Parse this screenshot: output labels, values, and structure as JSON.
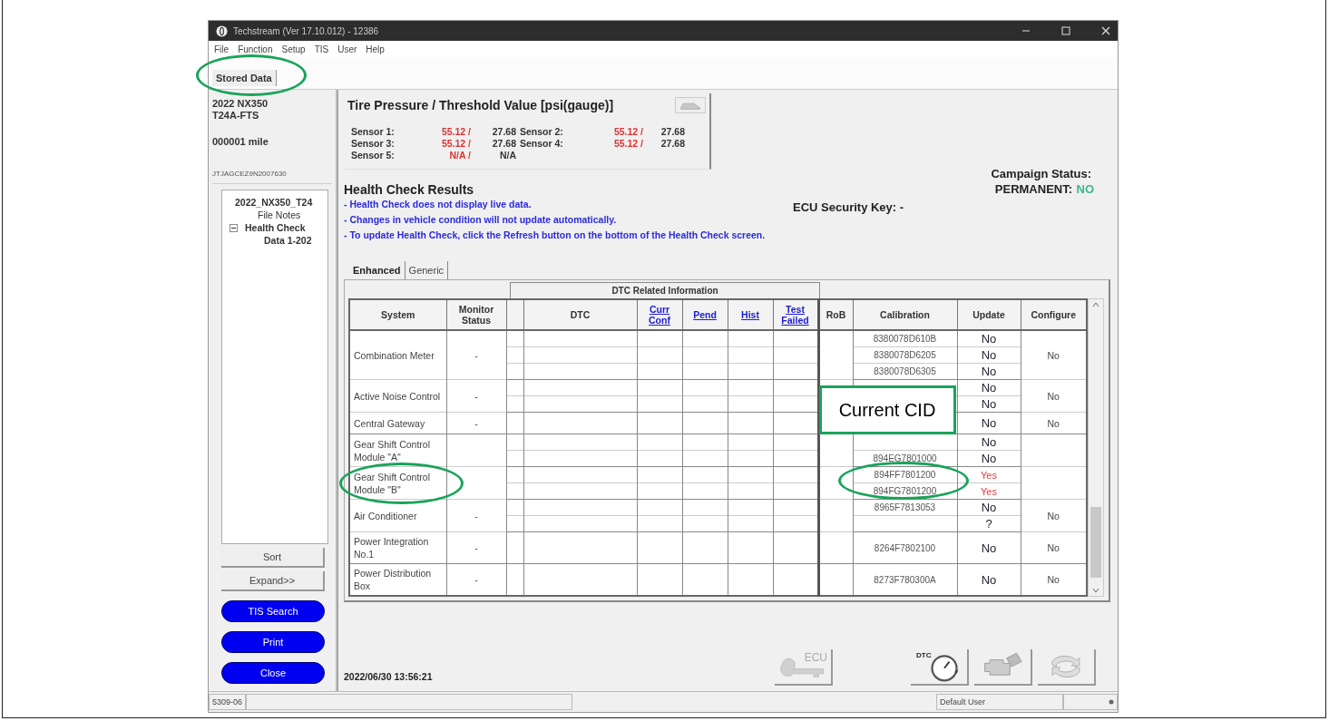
{
  "window": {
    "title": "Techstream (Ver 17.10.012) - 12386"
  },
  "menu": [
    "File",
    "Function",
    "Setup",
    "TIS",
    "User",
    "Help"
  ],
  "toolbar_tabs": [
    {
      "label": "Stored Data",
      "circled": true
    }
  ],
  "vehicle": {
    "model": "2022 NX350",
    "engine": "T24A-FTS",
    "mileage": "000001 mile",
    "vin": "JTJAGCEZ9N2007630"
  },
  "file_tree": [
    {
      "label": "2022_NX350_T24",
      "children": [
        {
          "label": "File Notes",
          "expanded": false
        },
        {
          "label": "Health Check",
          "expanded": true,
          "children": [
            {
              "label": "Data 1-202"
            }
          ]
        }
      ]
    }
  ],
  "side_buttons": [
    {
      "label": "Sort",
      "kind": "plain"
    },
    {
      "label": "Expand>>",
      "kind": "plain"
    },
    {
      "label": "TIS Search",
      "kind": "pill"
    },
    {
      "label": "Print",
      "kind": "pill"
    },
    {
      "label": "Close",
      "kind": "pill"
    }
  ],
  "tire_pressure": {
    "title": "Tire Pressure / Threshold Value [psi(gauge)]",
    "sensors": [
      {
        "label": "Sensor 1:",
        "value": "55.12 /",
        "threshold": "27.68",
        "alert": true
      },
      {
        "label": "Sensor 2:",
        "value": "55.12 /",
        "threshold": "27.68",
        "alert": true
      },
      {
        "label": "Sensor 3:",
        "value": "55.12 /",
        "threshold": "27.68",
        "alert": true
      },
      {
        "label": "Sensor 4:",
        "value": "55.12 /",
        "threshold": "27.68",
        "alert": true
      },
      {
        "label": "Sensor 5:",
        "value": "N/A /",
        "threshold": "N/A",
        "alert": true
      }
    ]
  },
  "campaign": {
    "label": "Campaign Status:",
    "permanent_label": "PERMANENT:",
    "permanent_value": "NO"
  },
  "health_check": {
    "title": "Health Check Results",
    "security_key": "ECU Security Key: -",
    "notes": [
      "- Health Check does not display live data.",
      "- Changes in vehicle condition will not update automatically.",
      "- To update Health Check, click the Refresh button on the bottom of the Health Check screen."
    ]
  },
  "result_tabs": [
    {
      "label": "Enhanced",
      "selected": true
    },
    {
      "label": "Generic",
      "selected": false
    }
  ],
  "table": {
    "group_header": "DTC Related Information",
    "columns": [
      {
        "label": "System",
        "kind": "text"
      },
      {
        "label": "Monitor Status",
        "kind": "text"
      },
      {
        "kind": "blank"
      },
      {
        "label": "DTC",
        "kind": "text"
      },
      {
        "label": "Curr Conf",
        "kind": "link"
      },
      {
        "label": "Pend",
        "kind": "link"
      },
      {
        "label": "Hist",
        "kind": "link"
      },
      {
        "label": "Test Failed",
        "kind": "link"
      },
      {
        "label": "RoB",
        "kind": "text"
      },
      {
        "label": "Calibration",
        "kind": "text"
      },
      {
        "label": "Update",
        "kind": "text"
      },
      {
        "label": "Configure",
        "kind": "text"
      }
    ],
    "rows": [
      {
        "system": "Combination Meter",
        "monitor_status": "-",
        "configure": "No",
        "system_circled": false,
        "calibration_circled": false,
        "entries": [
          {
            "calibration": "8380078D610B",
            "update": "No",
            "flagged": false
          },
          {
            "calibration": "8380078D6205",
            "update": "No",
            "flagged": false
          },
          {
            "calibration": "8380078D6305",
            "update": "No",
            "flagged": false
          }
        ]
      },
      {
        "system": "Active Noise Control",
        "monitor_status": "-",
        "configure": "No",
        "system_circled": false,
        "calibration_circled": false,
        "callout": "Current CID",
        "entries": [
          {
            "update": "No",
            "flagged": false
          },
          {
            "update": "No",
            "flagged": false
          }
        ]
      },
      {
        "system": "Central Gateway",
        "monitor_status": "-",
        "configure": "No",
        "system_circled": false,
        "calibration_circled": false,
        "entries": [
          {
            "update": "No",
            "flagged": false
          }
        ]
      },
      {
        "system": "Gear Shift Control Module \"A\"",
        "system_circled": false,
        "calibration_circled": false,
        "entries": [
          {
            "update": "No",
            "flagged": false
          },
          {
            "calibration": "894EG7801000",
            "update": "No",
            "flagged": false
          }
        ]
      },
      {
        "system": "Gear Shift Control Module \"B\"",
        "system_circled": true,
        "calibration_circled": true,
        "entries": [
          {
            "calibration": "894FF7801200",
            "update": "Yes",
            "flagged": true
          },
          {
            "calibration": "894FG7801200",
            "update": "Yes",
            "flagged": true
          }
        ]
      },
      {
        "system": "Air Conditioner",
        "monitor_status": "-",
        "configure": "No",
        "system_circled": false,
        "calibration_circled": false,
        "entries": [
          {
            "calibration": "8965F7813053",
            "update": "No",
            "flagged": false
          },
          {
            "update": "?",
            "flagged": false
          }
        ]
      },
      {
        "system": "Power Integration No.1",
        "monitor_status": "-",
        "configure": "No",
        "system_circled": false,
        "calibration_circled": false,
        "entries": [
          {
            "calibration": "8264F7802100",
            "update": "No",
            "flagged": false
          }
        ]
      },
      {
        "system": "Power Distribution Box",
        "monitor_status": "-",
        "configure": "No",
        "system_circled": false,
        "calibration_circled": false,
        "entries": [
          {
            "calibration": "8273F780300A",
            "update": "No",
            "flagged": false
          }
        ]
      }
    ]
  },
  "timestamp": "2022/06/30 13:56:21",
  "action_buttons": [
    {
      "kind": "ecu",
      "label": "ECU"
    },
    {
      "kind": "dtc",
      "label": "DTC"
    },
    {
      "kind": "engine"
    },
    {
      "kind": "refresh"
    }
  ],
  "status_bar": {
    "code": "5309-06",
    "user": "Default User"
  }
}
